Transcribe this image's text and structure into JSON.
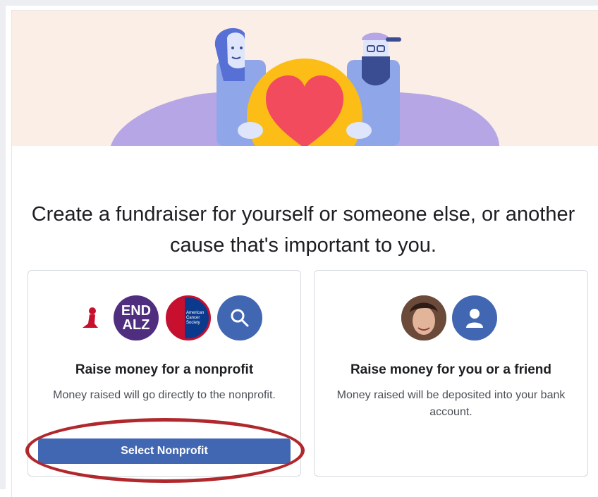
{
  "heading": "Create a fundraiser for yourself or someone else, or another cause that's important to you.",
  "nonprofit_card": {
    "logos": [
      {
        "name": "st-jude-logo"
      },
      {
        "name": "endalz-logo",
        "line1": "END",
        "line2": "ALZ"
      },
      {
        "name": "american-cancer-society-logo",
        "text": "American Cancer Society"
      },
      {
        "name": "search-icon"
      }
    ],
    "title": "Raise money for a nonprofit",
    "description": "Money raised will go directly to the nonprofit.",
    "button_label": "Select Nonprofit"
  },
  "personal_card": {
    "title": "Raise money for you or a friend",
    "description": "Money raised will be deposited into your bank account."
  },
  "colors": {
    "brand_blue": "#4267b2",
    "heart_red": "#f24b5e",
    "heart_circle": "#fbbd16",
    "highlight_oval": "#b0282c"
  }
}
